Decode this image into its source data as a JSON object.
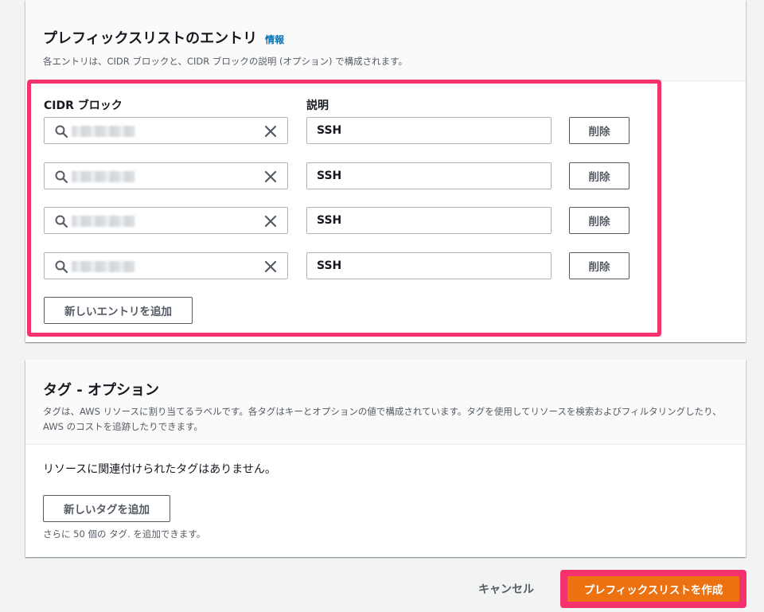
{
  "entries_section": {
    "title": "プレフィックスリストのエントリ",
    "info_link": "情報",
    "description": "各エントリは、CIDR ブロックと、CIDR ブロックの説明 (オプション) で構成されます。",
    "cidr_label": "CIDR ブロック",
    "desc_label": "説明",
    "entries": [
      {
        "description": "SSH",
        "delete_label": "削除"
      },
      {
        "description": "SSH",
        "delete_label": "削除"
      },
      {
        "description": "SSH",
        "delete_label": "削除"
      },
      {
        "description": "SSH",
        "delete_label": "削除"
      }
    ],
    "add_entry_label": "新しいエントリを追加"
  },
  "tags_section": {
    "title": "タグ - オプション",
    "description": "タグは、AWS リソースに割り当てるラベルです。各タグはキーとオプションの値で構成されています。タグを使用してリソースを検索およびフィルタリングしたり、AWS のコストを追跡したりできます。",
    "empty_text": "リソースに関連付けられたタグはありません。",
    "add_tag_label": "新しいタグを追加",
    "remaining_text": "さらに 50 個の タグ. を追加できます。"
  },
  "footer": {
    "cancel_label": "キャンセル",
    "create_label": "プレフィックスリストを作成"
  },
  "colors": {
    "primary_button": "#ec7211",
    "highlight": "#f4326e",
    "link": "#0073bb"
  },
  "icons": {
    "search": "search-icon",
    "clear": "close-icon"
  }
}
